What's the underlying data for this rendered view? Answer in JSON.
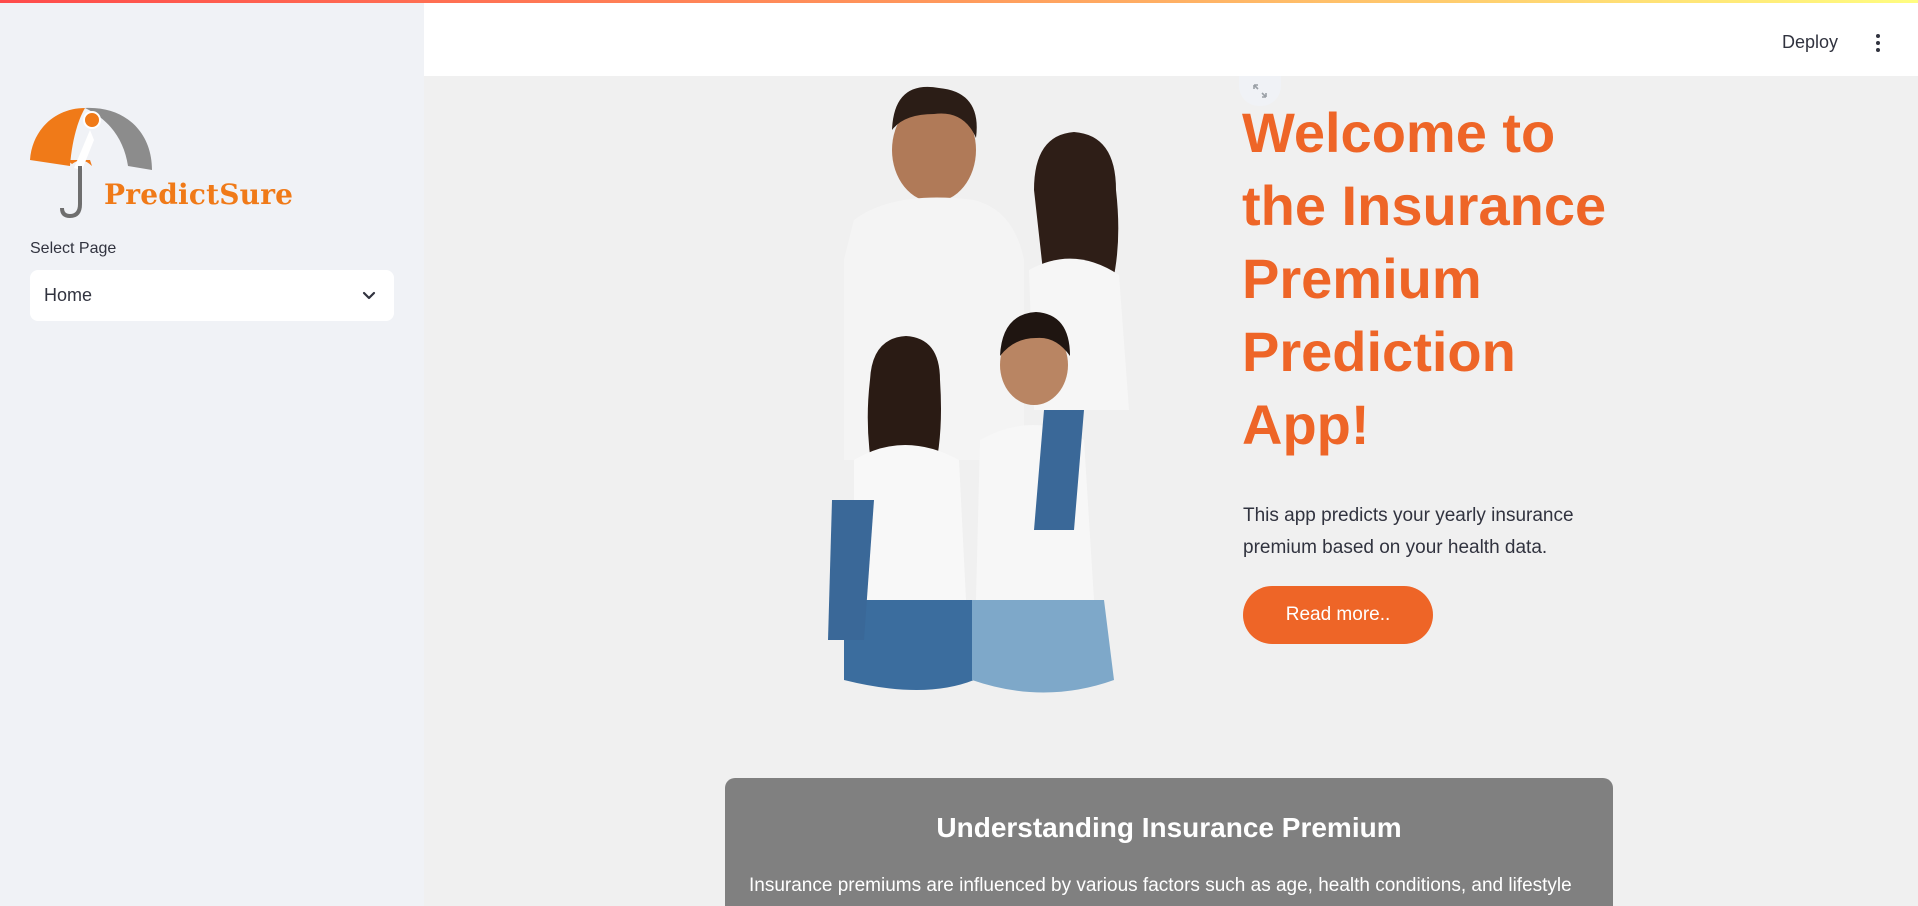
{
  "sidebar": {
    "logo_text": "PredictSure",
    "select_label": "Select Page",
    "select_value": "Home"
  },
  "header": {
    "deploy_label": "Deploy"
  },
  "main": {
    "welcome_title": "Welcome to the Insurance Premium Prediction App!",
    "description": "This app predicts your yearly insurance premium based on your health data.",
    "read_more_label": "Read more..",
    "card": {
      "title": "Understanding Insurance Premium",
      "text": "Insurance premiums are influenced by various factors such as age, health conditions, and lifestyle"
    }
  },
  "colors": {
    "accent": "#ee6527",
    "sidebar_bg": "#f0f2f6",
    "card_bg": "#808080"
  },
  "icons": [
    "umbrella-logo-icon",
    "chevron-down-icon",
    "kebab-menu-icon",
    "expand-icon"
  ]
}
